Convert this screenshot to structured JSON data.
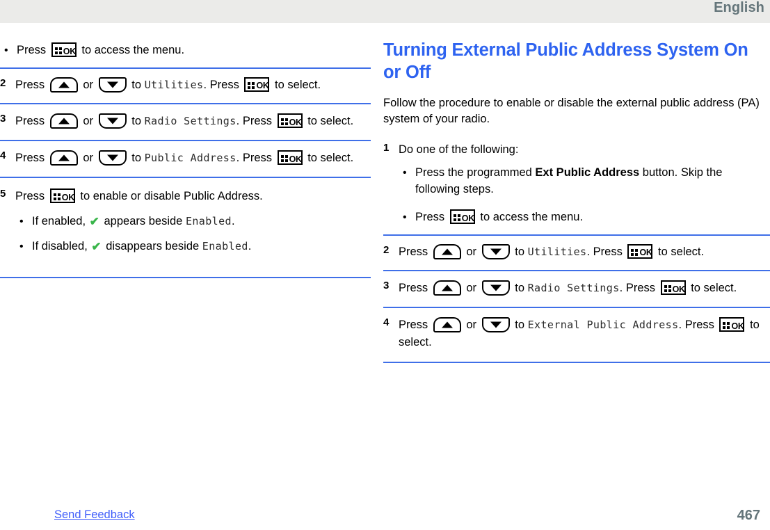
{
  "header": {
    "language": "English"
  },
  "footer": {
    "feedback_link": "Send Feedback",
    "page_number": "467"
  },
  "glyphs": {
    "ok_label": "OK",
    "check": "✔"
  },
  "left_column": {
    "continued_bullet": {
      "dot": "•",
      "press": "Press",
      "after": "to access the menu."
    },
    "steps": [
      {
        "number": "2",
        "press": "Press",
        "or": "or",
        "to": "to",
        "menu": "Utilities",
        "period": ".",
        "press2": "Press",
        "tail": "to select."
      },
      {
        "number": "3",
        "press": "Press",
        "or": "or",
        "to": "to",
        "menu": "Radio Settings",
        "period": ".",
        "press2": "Press",
        "tail": "to select."
      },
      {
        "number": "4",
        "press": "Press",
        "or": "or",
        "to": "to",
        "menu": "Public Address",
        "period": ".",
        "press2": "Press",
        "tail": "to select."
      }
    ],
    "step5": {
      "number": "5",
      "press": "Press",
      "tail": "to enable or disable Public Address.",
      "bullets": [
        {
          "dot": "•",
          "pre": "If enabled,",
          "mid": "appears beside",
          "menu": "Enabled",
          "period": "."
        },
        {
          "dot": "•",
          "pre": "If disabled,",
          "mid": "disappears beside",
          "menu": "Enabled",
          "period": "."
        }
      ]
    }
  },
  "right_column": {
    "title": "Turning External Public Address System On or Off",
    "intro": "Follow the procedure to enable or disable the external public address (PA) system of your radio.",
    "step1": {
      "number": "1",
      "text": "Do one of the following:",
      "bullets": [
        {
          "dot": "•",
          "pre": "Press the programmed",
          "bold": "Ext Public Address",
          "post": "button. Skip the following steps."
        },
        {
          "dot": "•",
          "pre": "Press",
          "post": "to access the menu."
        }
      ]
    },
    "steps": [
      {
        "number": "2",
        "press": "Press",
        "or": "or",
        "to": "to",
        "menu": "Utilities",
        "period": ".",
        "press2": "Press",
        "tail": "to select."
      },
      {
        "number": "3",
        "press": "Press",
        "or": "or",
        "to": "to",
        "menu": "Radio Settings",
        "period": ".",
        "press2": "Press",
        "tail": "to select."
      },
      {
        "number": "4",
        "press": "Press",
        "or": "or",
        "to": "to",
        "menu": "External Public Address",
        "period": ".",
        "press2": "Press",
        "tail": "to select."
      }
    ]
  }
}
